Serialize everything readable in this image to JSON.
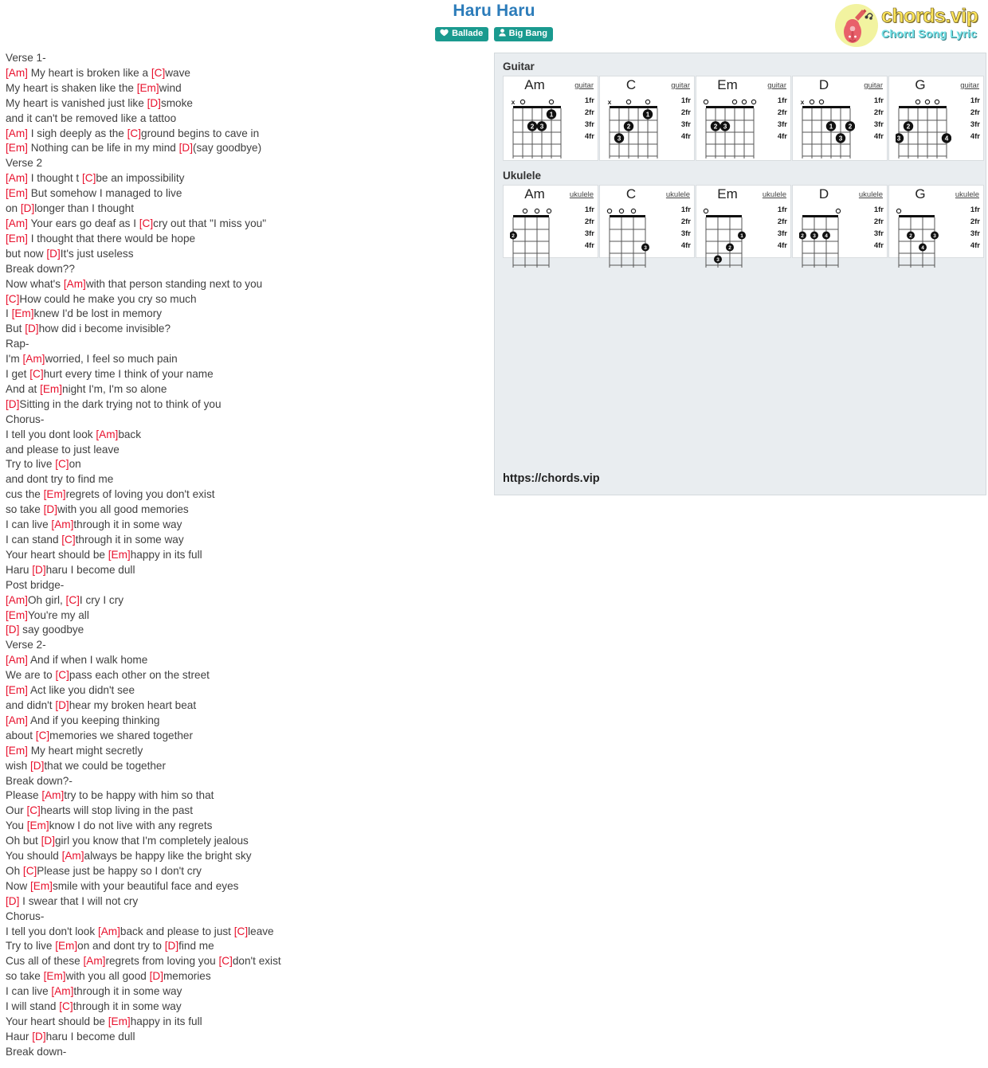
{
  "header": {
    "title": "Haru Haru",
    "tags": [
      {
        "label": "Ballade",
        "icon": "heart-icon"
      },
      {
        "label": "Big Bang",
        "icon": "user-icon"
      }
    ],
    "logo": {
      "main": "chords.vip",
      "sub": "Chord Song Lyric",
      "icon": "guitar-icon"
    }
  },
  "lyrics": [
    {
      "text": "Verse 1-"
    },
    {
      "parts": [
        {
          "c": "[Am]"
        },
        {
          "t": " My heart is broken like a "
        },
        {
          "c": "[C]"
        },
        {
          "t": "wave"
        }
      ]
    },
    {
      "parts": [
        {
          "t": "My heart is shaken like the "
        },
        {
          "c": "[Em]"
        },
        {
          "t": "wind"
        }
      ]
    },
    {
      "parts": [
        {
          "t": "My heart is vanished just like "
        },
        {
          "c": "[D]"
        },
        {
          "t": "smoke"
        }
      ]
    },
    {
      "text": "and it can't be removed like a tattoo"
    },
    {
      "parts": [
        {
          "c": "[Am]"
        },
        {
          "t": " I sigh deeply as the "
        },
        {
          "c": "[C]"
        },
        {
          "t": "ground begins to cave in"
        }
      ]
    },
    {
      "parts": [
        {
          "c": "[Em]"
        },
        {
          "t": " Nothing can be life in my mind "
        },
        {
          "c": "[D]"
        },
        {
          "t": "(say goodbye)"
        }
      ]
    },
    {
      "text": "Verse 2"
    },
    {
      "parts": [
        {
          "c": "[Am]"
        },
        {
          "t": " I thought t "
        },
        {
          "c": "[C]"
        },
        {
          "t": "be an impossibility"
        }
      ]
    },
    {
      "parts": [
        {
          "c": "[Em]"
        },
        {
          "t": " But somehow I managed to live"
        }
      ]
    },
    {
      "parts": [
        {
          "t": "on "
        },
        {
          "c": "[D]"
        },
        {
          "t": "longer than I thought"
        }
      ]
    },
    {
      "parts": [
        {
          "c": "[Am]"
        },
        {
          "t": " Your ears go deaf as I "
        },
        {
          "c": "[C]"
        },
        {
          "t": "cry out that \"I miss you\""
        }
      ]
    },
    {
      "parts": [
        {
          "c": "[Em]"
        },
        {
          "t": " I thought that there would be hope"
        }
      ]
    },
    {
      "parts": [
        {
          "t": "but now "
        },
        {
          "c": "[D]"
        },
        {
          "t": "It's just useless"
        }
      ]
    },
    {
      "text": "Break down??"
    },
    {
      "parts": [
        {
          "t": "Now what's "
        },
        {
          "c": "[Am]"
        },
        {
          "t": "with that person standing next to you"
        }
      ]
    },
    {
      "parts": [
        {
          "c": "[C]"
        },
        {
          "t": "How could he make you cry so much"
        }
      ]
    },
    {
      "parts": [
        {
          "t": "I "
        },
        {
          "c": "[Em]"
        },
        {
          "t": "knew I'd be lost in memory"
        }
      ]
    },
    {
      "parts": [
        {
          "t": "But "
        },
        {
          "c": "[D]"
        },
        {
          "t": "how did i become invisible?"
        }
      ]
    },
    {
      "text": "Rap-"
    },
    {
      "parts": [
        {
          "t": "I'm "
        },
        {
          "c": "[Am]"
        },
        {
          "t": "worried, I feel so much pain"
        }
      ]
    },
    {
      "parts": [
        {
          "t": "I get "
        },
        {
          "c": "[C]"
        },
        {
          "t": "hurt every time I think of your name"
        }
      ]
    },
    {
      "parts": [
        {
          "t": "And at "
        },
        {
          "c": "[Em]"
        },
        {
          "t": "night I'm, I'm so alone"
        }
      ]
    },
    {
      "parts": [
        {
          "c": "[D]"
        },
        {
          "t": "Sitting in the dark trying not to think of you"
        }
      ]
    },
    {
      "text": "Chorus-"
    },
    {
      "parts": [
        {
          "t": "I tell you dont look "
        },
        {
          "c": "[Am]"
        },
        {
          "t": "back"
        }
      ]
    },
    {
      "text": "and please to just leave"
    },
    {
      "parts": [
        {
          "t": "Try to live "
        },
        {
          "c": "[C]"
        },
        {
          "t": "on"
        }
      ]
    },
    {
      "text": "and dont try to find me"
    },
    {
      "parts": [
        {
          "t": "cus the "
        },
        {
          "c": "[Em]"
        },
        {
          "t": "regrets of loving you don't exist"
        }
      ]
    },
    {
      "parts": [
        {
          "t": "so take "
        },
        {
          "c": "[D]"
        },
        {
          "t": "with you all good memories"
        }
      ]
    },
    {
      "parts": [
        {
          "t": "I can live "
        },
        {
          "c": "[Am]"
        },
        {
          "t": "through it in some way"
        }
      ]
    },
    {
      "parts": [
        {
          "t": "I can stand "
        },
        {
          "c": "[C]"
        },
        {
          "t": "through it in some way"
        }
      ]
    },
    {
      "parts": [
        {
          "t": "Your heart should be "
        },
        {
          "c": "[Em]"
        },
        {
          "t": "happy in its full"
        }
      ]
    },
    {
      "parts": [
        {
          "t": "Haru "
        },
        {
          "c": "[D]"
        },
        {
          "t": "haru I become dull"
        }
      ]
    },
    {
      "text": "Post bridge-"
    },
    {
      "parts": [
        {
          "c": "[Am]"
        },
        {
          "t": "Oh girl, "
        },
        {
          "c": "[C]"
        },
        {
          "t": "I cry I cry"
        }
      ]
    },
    {
      "parts": [
        {
          "c": "[Em]"
        },
        {
          "t": "You're my all"
        }
      ]
    },
    {
      "parts": [
        {
          "c": "[D]"
        },
        {
          "t": " say goodbye"
        }
      ]
    },
    {
      "text": "Verse 2-"
    },
    {
      "parts": [
        {
          "c": "[Am]"
        },
        {
          "t": " And if when I walk home"
        }
      ]
    },
    {
      "parts": [
        {
          "t": "We are to "
        },
        {
          "c": "[C]"
        },
        {
          "t": "pass each other on the street"
        }
      ]
    },
    {
      "parts": [
        {
          "c": "[Em]"
        },
        {
          "t": " Act like you didn't see"
        }
      ]
    },
    {
      "parts": [
        {
          "t": "and didn't "
        },
        {
          "c": "[D]"
        },
        {
          "t": "hear my broken heart beat"
        }
      ]
    },
    {
      "parts": [
        {
          "c": "[Am]"
        },
        {
          "t": " And if you keeping thinking"
        }
      ]
    },
    {
      "parts": [
        {
          "t": "about "
        },
        {
          "c": "[C]"
        },
        {
          "t": "memories we shared together"
        }
      ]
    },
    {
      "parts": [
        {
          "c": "[Em]"
        },
        {
          "t": " My heart might secretly"
        }
      ]
    },
    {
      "parts": [
        {
          "t": "wish "
        },
        {
          "c": "[D]"
        },
        {
          "t": "that we could be together"
        }
      ]
    },
    {
      "text": "Break down?-"
    },
    {
      "parts": [
        {
          "t": "Please "
        },
        {
          "c": "[Am]"
        },
        {
          "t": "try to be happy with him so that"
        }
      ]
    },
    {
      "parts": [
        {
          "t": "Our "
        },
        {
          "c": "[C]"
        },
        {
          "t": "hearts will stop living in the past"
        }
      ]
    },
    {
      "parts": [
        {
          "t": "You "
        },
        {
          "c": "[Em]"
        },
        {
          "t": "know I do not live with any regrets"
        }
      ]
    },
    {
      "parts": [
        {
          "t": "Oh but "
        },
        {
          "c": "[D]"
        },
        {
          "t": "girl you know that I'm completely jealous"
        }
      ]
    },
    {
      "parts": [
        {
          "t": "You should "
        },
        {
          "c": "[Am]"
        },
        {
          "t": "always be happy like the bright sky"
        }
      ]
    },
    {
      "parts": [
        {
          "t": "Oh "
        },
        {
          "c": "[C]"
        },
        {
          "t": "Please just be happy so I don't cry"
        }
      ]
    },
    {
      "parts": [
        {
          "t": "Now "
        },
        {
          "c": "[Em]"
        },
        {
          "t": "smile with your beautiful face and eyes"
        }
      ]
    },
    {
      "parts": [
        {
          "c": "[D]"
        },
        {
          "t": " I swear that I will not cry"
        }
      ]
    },
    {
      "text": "Chorus-"
    },
    {
      "parts": [
        {
          "t": "I tell you don't look "
        },
        {
          "c": "[Am]"
        },
        {
          "t": "back and please to just "
        },
        {
          "c": "[C]"
        },
        {
          "t": "leave"
        }
      ]
    },
    {
      "parts": [
        {
          "t": "Try to live "
        },
        {
          "c": "[Em]"
        },
        {
          "t": "on and dont try to "
        },
        {
          "c": "[D]"
        },
        {
          "t": "find me"
        }
      ]
    },
    {
      "parts": [
        {
          "t": "Cus all of these "
        },
        {
          "c": "[Am]"
        },
        {
          "t": "regrets from loving you "
        },
        {
          "c": "[C]"
        },
        {
          "t": "don't exist"
        }
      ]
    },
    {
      "parts": [
        {
          "t": "so take "
        },
        {
          "c": "[Em]"
        },
        {
          "t": "with you all good "
        },
        {
          "c": "[D]"
        },
        {
          "t": "memories"
        }
      ]
    },
    {
      "parts": [
        {
          "t": "I can live "
        },
        {
          "c": "[Am]"
        },
        {
          "t": "through it in some way"
        }
      ]
    },
    {
      "parts": [
        {
          "t": "I will stand "
        },
        {
          "c": "[C]"
        },
        {
          "t": "through it in some way"
        }
      ]
    },
    {
      "parts": [
        {
          "t": "Your heart should be "
        },
        {
          "c": "[Em]"
        },
        {
          "t": "happy in its full"
        }
      ]
    },
    {
      "parts": [
        {
          "t": "Haur "
        },
        {
          "c": "[D]"
        },
        {
          "t": "haru I become dull"
        }
      ]
    },
    {
      "text": "Break down-"
    }
  ],
  "panel": {
    "guitar_heading": "Guitar",
    "ukulele_heading": "Ukulele",
    "fret_labels": [
      "1fr",
      "2fr",
      "3fr",
      "4fr"
    ],
    "url": "https://chords.vip",
    "guitar": [
      {
        "name": "Am",
        "type": "guitar",
        "strings": 6,
        "open": [
          "x",
          "o",
          "",
          "",
          "o",
          ""
        ],
        "dots": [
          {
            "s": 5,
            "f": 1,
            "n": "1"
          },
          {
            "s": 3,
            "f": 2,
            "n": "2"
          },
          {
            "s": 4,
            "f": 2,
            "n": "3"
          }
        ]
      },
      {
        "name": "C",
        "type": "guitar",
        "strings": 6,
        "open": [
          "x",
          "",
          "o",
          "",
          "o",
          ""
        ],
        "dots": [
          {
            "s": 5,
            "f": 1,
            "n": "1"
          },
          {
            "s": 3,
            "f": 2,
            "n": "2"
          },
          {
            "s": 2,
            "f": 3,
            "n": "3"
          }
        ]
      },
      {
        "name": "Em",
        "type": "guitar",
        "strings": 6,
        "open": [
          "o",
          "",
          "",
          "o",
          "o",
          "o"
        ],
        "dots": [
          {
            "s": 2,
            "f": 2,
            "n": "2"
          },
          {
            "s": 3,
            "f": 2,
            "n": "3"
          }
        ]
      },
      {
        "name": "D",
        "type": "guitar",
        "strings": 6,
        "open": [
          "x",
          "o",
          "o",
          "",
          "",
          ""
        ],
        "dots": [
          {
            "s": 4,
            "f": 2,
            "n": "1"
          },
          {
            "s": 6,
            "f": 2,
            "n": "2"
          },
          {
            "s": 5,
            "f": 3,
            "n": "3"
          }
        ]
      },
      {
        "name": "G",
        "type": "guitar",
        "strings": 6,
        "open": [
          "",
          "",
          "o",
          "o",
          "o",
          ""
        ],
        "dots": [
          {
            "s": 2,
            "f": 2,
            "n": "2"
          },
          {
            "s": 1,
            "f": 3,
            "n": "3"
          },
          {
            "s": 6,
            "f": 3,
            "n": "4"
          }
        ]
      }
    ],
    "ukulele": [
      {
        "name": "Am",
        "type": "ukulele",
        "strings": 4,
        "open": [
          "",
          "o",
          "o",
          "o"
        ],
        "dots": [
          {
            "s": 1,
            "f": 2,
            "n": "2"
          }
        ]
      },
      {
        "name": "C",
        "type": "ukulele",
        "strings": 4,
        "open": [
          "o",
          "o",
          "o",
          ""
        ],
        "dots": [
          {
            "s": 4,
            "f": 3,
            "n": "3"
          }
        ]
      },
      {
        "name": "Em",
        "type": "ukulele",
        "strings": 4,
        "open": [
          "o",
          "",
          "",
          ""
        ],
        "dots": [
          {
            "s": 4,
            "f": 2,
            "n": "1"
          },
          {
            "s": 3,
            "f": 3,
            "n": "2"
          },
          {
            "s": 2,
            "f": 4,
            "n": "3"
          }
        ]
      },
      {
        "name": "D",
        "type": "ukulele",
        "strings": 4,
        "open": [
          "",
          "",
          "",
          "o"
        ],
        "dots": [
          {
            "s": 1,
            "f": 2,
            "n": "2"
          },
          {
            "s": 2,
            "f": 2,
            "n": "3"
          },
          {
            "s": 3,
            "f": 2,
            "n": "4"
          }
        ]
      },
      {
        "name": "G",
        "type": "ukulele",
        "strings": 4,
        "open": [
          "o",
          "",
          "",
          ""
        ],
        "dots": [
          {
            "s": 2,
            "f": 2,
            "n": "2"
          },
          {
            "s": 4,
            "f": 2,
            "n": "3"
          },
          {
            "s": 3,
            "f": 3,
            "n": "4"
          }
        ]
      }
    ]
  },
  "colors": {
    "title": "#2c7cba",
    "chord": "#e8112d",
    "tag": "#1a9a8f",
    "panel_bg": "#e9edf0"
  }
}
